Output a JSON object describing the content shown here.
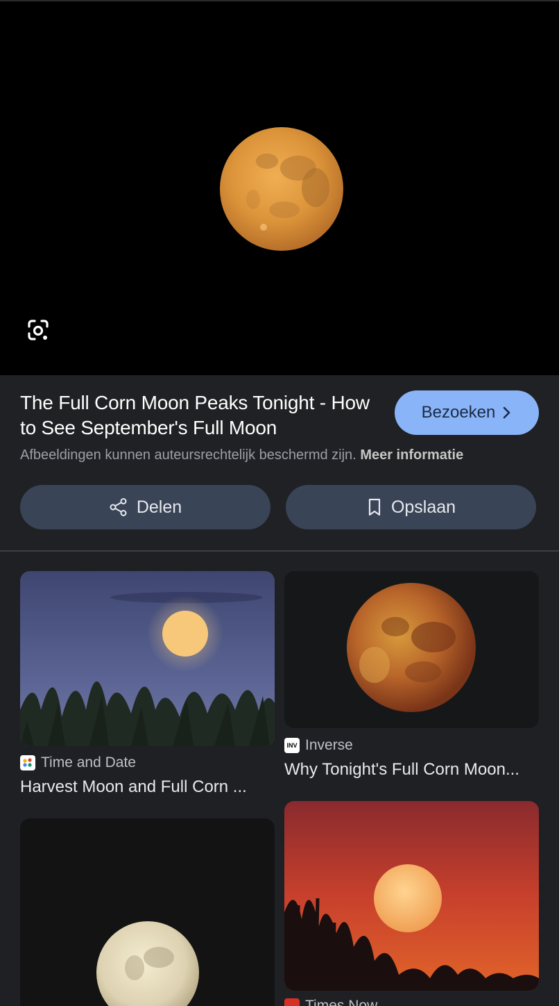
{
  "hero": {
    "image": "full-orange-moon-night-sky",
    "lens_icon": "google-lens-icon"
  },
  "result": {
    "title": "The Full Corn Moon Peaks Tonight - How to See September's Full Moon",
    "visit_label": "Bezoeken",
    "copyright_notice": "Afbeeldingen kunnen auteursrechtelijk beschermd zijn.",
    "more_info_label": "Meer informatie",
    "share_label": "Delen",
    "save_label": "Opslaan"
  },
  "related": [
    {
      "source": "Time and Date",
      "caption": "Harvest Moon and Full Corn ...",
      "image": "moon-rising-over-grass"
    },
    {
      "source": "Inverse",
      "caption": "Why Tonight's Full Corn Moon...",
      "image": "red-moon-closeup"
    },
    {
      "source": "",
      "caption": "",
      "image": "pale-full-moon-dark-sky"
    },
    {
      "source": "Times Now",
      "caption": "",
      "image": "orange-moon-red-sunset-trees"
    }
  ],
  "colors": {
    "background": "#202124",
    "visit_button": "#8ab4f8",
    "action_button": "#394457",
    "moon": "#e09a3c"
  }
}
